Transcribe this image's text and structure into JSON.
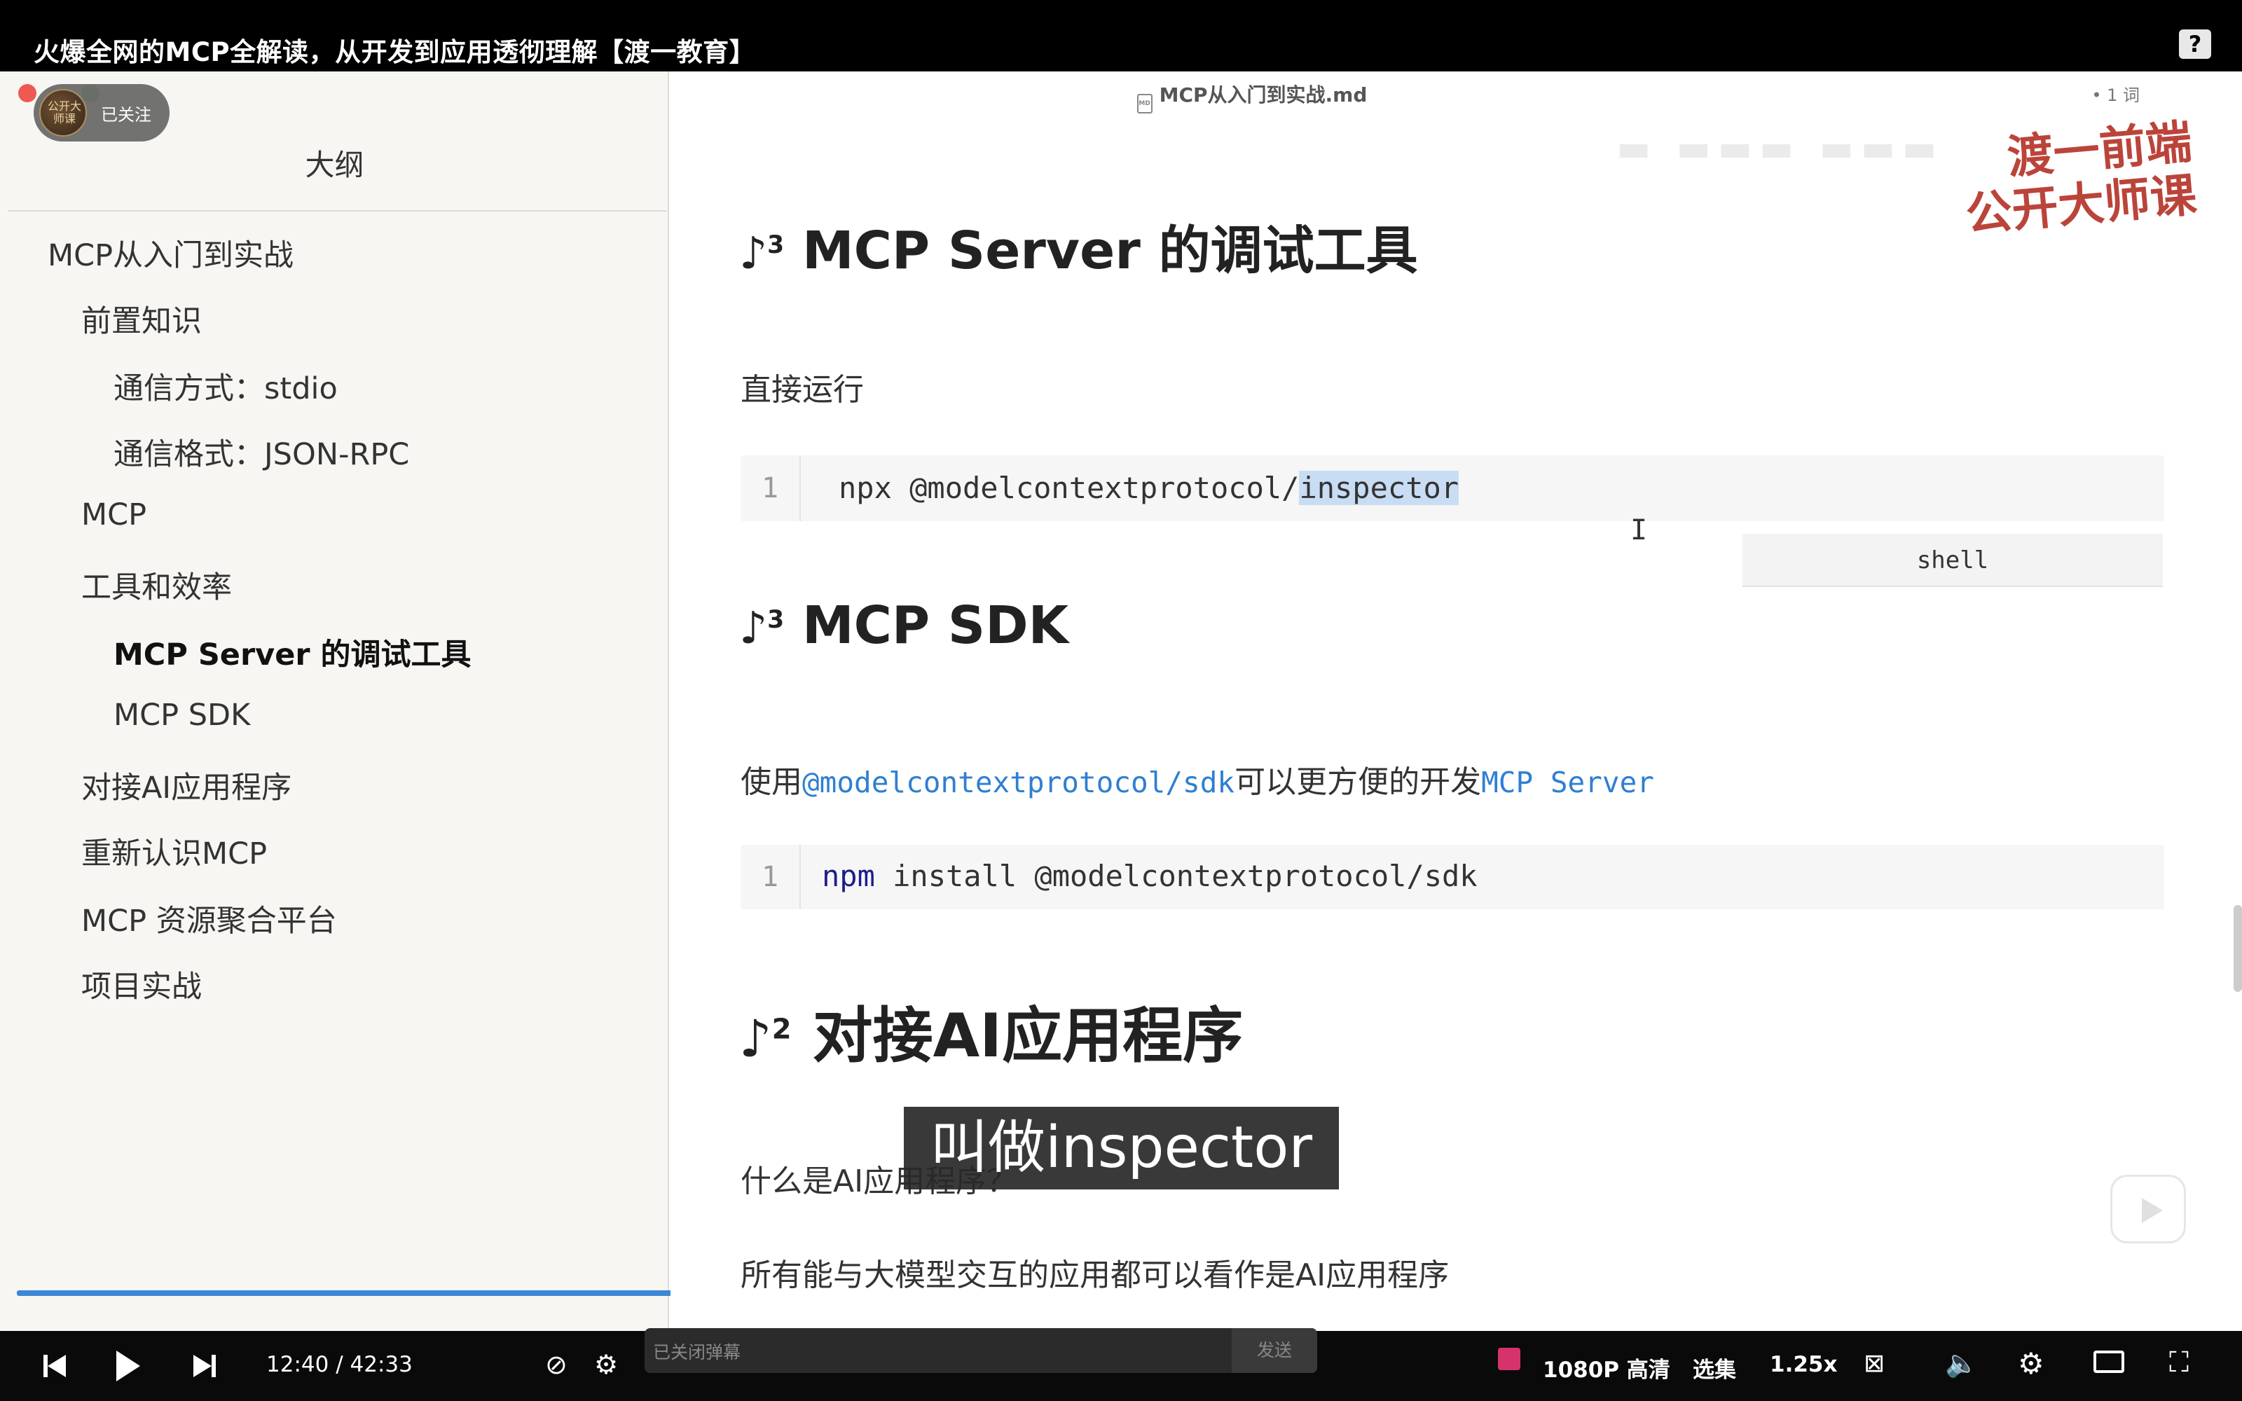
{
  "video": {
    "title": "火爆全网的MCP全解读，从开发到应用透彻理解【渡一教育】",
    "help_icon": "question-mark-icon"
  },
  "editor": {
    "filename": "MCP从入门到实战.md",
    "word_count": "• 1 词",
    "watermark_line1": "渡一前端",
    "watermark_line2": "公开大师课"
  },
  "follow": {
    "label": "已关注",
    "avatar_text": "公开大师课"
  },
  "sidebar": {
    "title": "大纲",
    "items": [
      {
        "label": "MCP从入门到实战",
        "level": 1
      },
      {
        "label": "前置知识",
        "level": 2
      },
      {
        "label": "通信方式：stdio",
        "level": 3
      },
      {
        "label": "通信格式：JSON-RPC",
        "level": 3
      },
      {
        "label": "MCP",
        "level": 2
      },
      {
        "label": "工具和效率",
        "level": 2
      },
      {
        "label": "MCP Server 的调试工具",
        "level": 3,
        "active": true
      },
      {
        "label": "MCP SDK",
        "level": 3
      },
      {
        "label": "对接AI应用程序",
        "level": 2
      },
      {
        "label": "重新认识MCP",
        "level": 2
      },
      {
        "label": "MCP 资源聚合平台",
        "level": 2
      },
      {
        "label": "项目实战",
        "level": 2
      }
    ]
  },
  "content": {
    "h_debug": {
      "mark": "♪",
      "level": "3",
      "text": "MCP Server 的调试工具"
    },
    "run_label": "直接运行",
    "code1": {
      "line": "1",
      "prefix": "npx @modelcontextprotocol/",
      "selected": "inspector",
      "lang": "shell"
    },
    "h_sdk": {
      "mark": "♪",
      "level": "3",
      "text": "MCP SDK"
    },
    "sdk_para": {
      "pre": "使用",
      "code1": "@modelcontextprotocol/sdk",
      "mid": "可以更方便的开发",
      "code2": "MCP Server"
    },
    "code2": {
      "line": "1",
      "kw": "npm",
      "rest": " install @modelcontextprotocol/sdk"
    },
    "h_ai": {
      "mark": "♪",
      "level": "2",
      "text": "对接AI应用程序"
    },
    "q_ai": "什么是AI应用程序？",
    "a_ai": "所有能与大模型交互的应用都可以看作是AI应用程序"
  },
  "subtitle": "叫做inspector",
  "player": {
    "current_time": "12:40",
    "separator": "/",
    "total_time": "42:33",
    "danmaku_placeholder": "已关闭弹幕",
    "send_label": "发送",
    "quality": "1080P 高清",
    "episodes": "选集",
    "speed": "1.25x"
  },
  "colors": {
    "accent_blue": "#3b88d6",
    "inline_code": "#2f7fd1",
    "watermark_red": "#b02418"
  }
}
